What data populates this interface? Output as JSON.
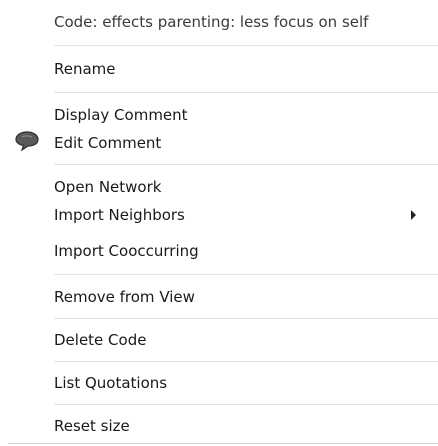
{
  "menu": {
    "header": "Code: effects parenting: less focus on self",
    "items": [
      {
        "label": "Rename"
      },
      {
        "label": "Display Comment"
      },
      {
        "label": "Edit Comment",
        "icon": "comment-bubble-icon"
      },
      {
        "label": "Open Network"
      },
      {
        "label": "Import Neighbors",
        "submenu": true
      },
      {
        "label": "Import Cooccurring"
      },
      {
        "label": "Remove from View"
      },
      {
        "label": "Delete Code"
      },
      {
        "label": "List Quotations"
      },
      {
        "label": "Reset size"
      }
    ]
  }
}
